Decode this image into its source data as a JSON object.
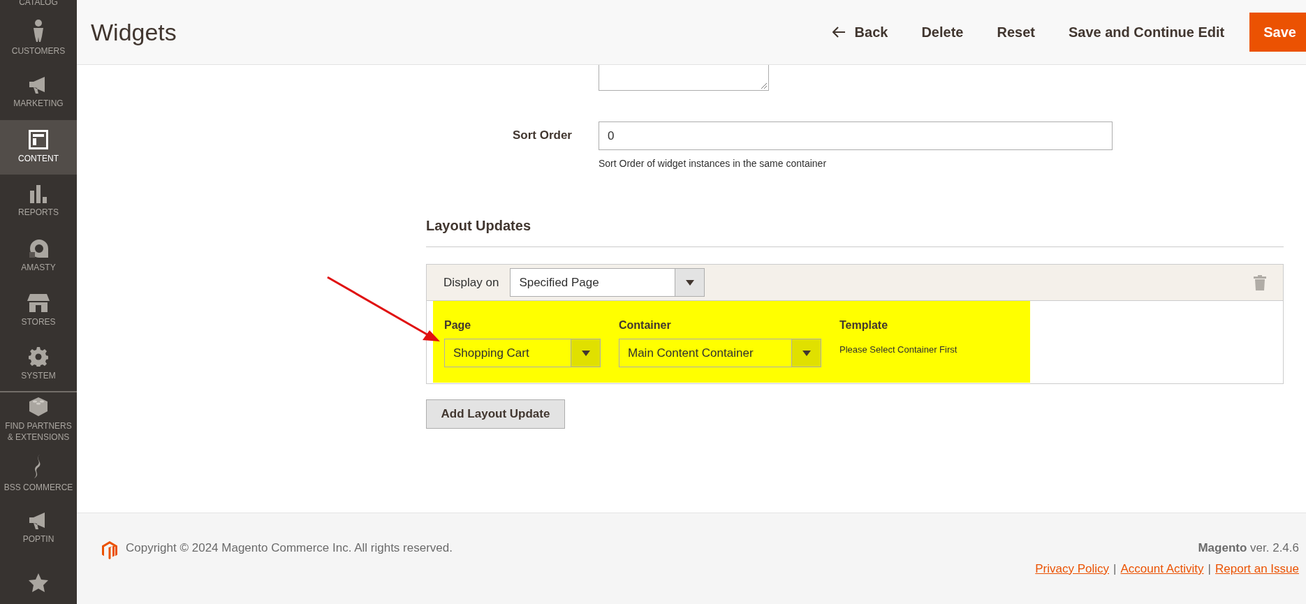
{
  "sidebar": {
    "items": [
      {
        "label": "CATALOG",
        "selected": false
      },
      {
        "label": "CUSTOMERS",
        "selected": false
      },
      {
        "label": "MARKETING",
        "selected": false
      },
      {
        "label": "CONTENT",
        "selected": true
      },
      {
        "label": "REPORTS",
        "selected": false
      },
      {
        "label": "AMASTY",
        "selected": false
      },
      {
        "label": "STORES",
        "selected": false
      },
      {
        "label": "SYSTEM",
        "selected": false
      },
      {
        "label": "FIND PARTNERS & EXTENSIONS",
        "selected": false
      },
      {
        "label": "BSS COMMERCE",
        "selected": false
      },
      {
        "label": "POPTIN",
        "selected": false
      },
      {
        "selected": false
      }
    ]
  },
  "header": {
    "title": "Widgets",
    "actions": [
      {
        "label": "Back",
        "kind": "back"
      },
      {
        "label": "Delete",
        "kind": "plain"
      },
      {
        "label": "Reset",
        "kind": "plain"
      },
      {
        "label": "Save and Continue Edit",
        "kind": "plain"
      },
      {
        "label": "Save",
        "kind": "primary"
      }
    ]
  },
  "sort_order": {
    "label": "Sort Order",
    "value": "0",
    "hint": "Sort Order of widget instances in the same container"
  },
  "layout_updates": {
    "title": "Layout Updates",
    "display_on": {
      "label": "Display on",
      "value": "Specified Page"
    },
    "fields": [
      {
        "label": "Page",
        "kind": "select",
        "value": "Shopping Cart"
      },
      {
        "label": "Container",
        "kind": "select",
        "value": "Main Content Container"
      },
      {
        "label": "Template",
        "kind": "note",
        "value": "Please Select Container First"
      }
    ],
    "add_button": "Add Layout Update"
  },
  "footer": {
    "copyright": "Copyright © 2024 Magento Commerce Inc. All rights reserved.",
    "brand": "Magento",
    "version": " ver. 2.4.6",
    "links": [
      "Privacy Policy",
      "Account Activity",
      "Report an Issue"
    ],
    "separator": "|"
  }
}
